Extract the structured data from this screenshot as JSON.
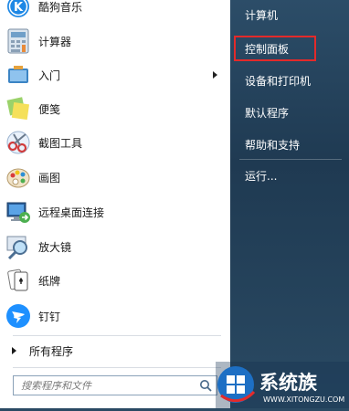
{
  "programs": [
    {
      "label": "酷狗音乐",
      "has_arrow": false
    },
    {
      "label": "计算器",
      "has_arrow": false
    },
    {
      "label": "入门",
      "has_arrow": true
    },
    {
      "label": "便笺",
      "has_arrow": false
    },
    {
      "label": "截图工具",
      "has_arrow": false
    },
    {
      "label": "画图",
      "has_arrow": false
    },
    {
      "label": "远程桌面连接",
      "has_arrow": false
    },
    {
      "label": "放大镜",
      "has_arrow": false
    },
    {
      "label": "纸牌",
      "has_arrow": false
    },
    {
      "label": "钉钉",
      "has_arrow": false
    }
  ],
  "all_programs_label": "所有程序",
  "search": {
    "placeholder": "搜索程序和文件"
  },
  "right_menu": [
    {
      "label": "计算机"
    },
    {
      "label": "控制面板"
    },
    {
      "label": "设备和打印机"
    },
    {
      "label": "默认程序"
    },
    {
      "label": "帮助和支持"
    },
    {
      "label": "运行..."
    }
  ],
  "highlighted_item": "控制面板",
  "highlight_color": "#e32a2a",
  "watermark": {
    "text": "系统族",
    "url_text": "WWW.XITONGZU.COM"
  }
}
